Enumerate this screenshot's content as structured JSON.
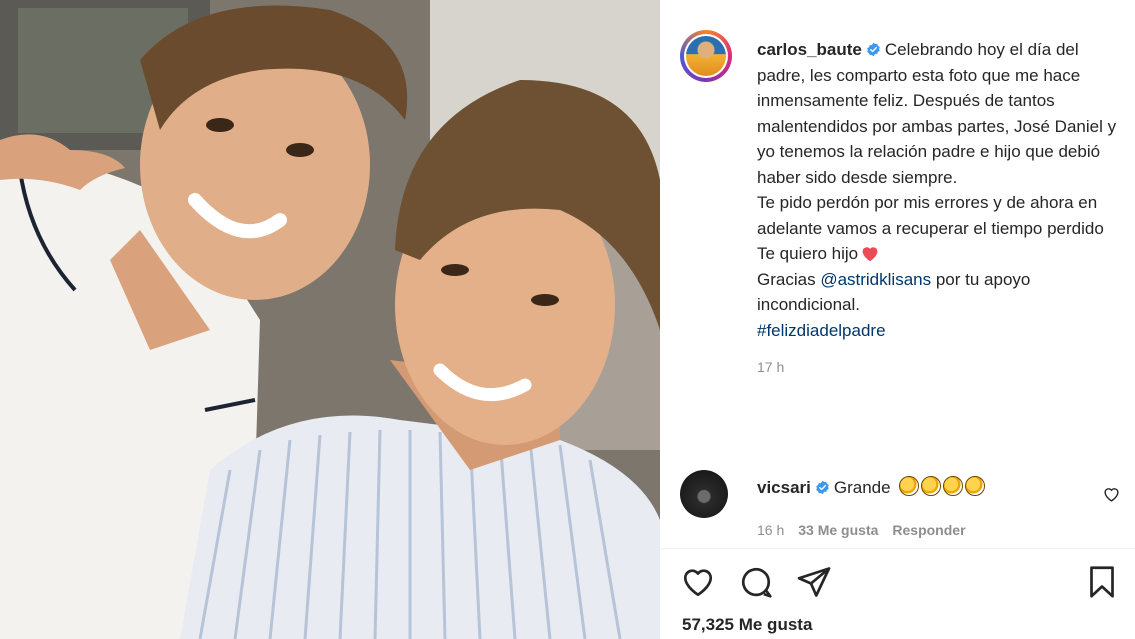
{
  "post": {
    "username": "carlos_baute",
    "caption_lines": [
      "Celebrando hoy el día del padre, les comparto esta foto que me hace inmensamente feliz. Después de tantos malentendidos por ambas partes, José Daniel y yo tenemos la relación padre e hijo que debió haber sido desde siempre.",
      "Te pido perdón por mis errores y de ahora en adelante vamos a recuperar el tiempo perdido",
      "Te quiero hijo"
    ],
    "thanks_prefix": "Gracias",
    "mention": "@astridklisans",
    "thanks_suffix": "por tu apoyo incondicional.",
    "hashtag": "#felizdiadelpadre",
    "timestamp": "17 h",
    "likes": "57,325 Me gusta"
  },
  "comment": {
    "username": "vicsari",
    "text": "Grande",
    "time": "16 h",
    "likes": "33 Me gusta",
    "reply": "Responder"
  },
  "icons": {
    "verified": "verified-badge-icon",
    "heart": "heart-icon",
    "comment": "comment-icon",
    "share": "share-icon",
    "save": "bookmark-icon"
  },
  "colors": {
    "verified": "#3897f0",
    "link": "#00376b",
    "muted": "#8e8e8e",
    "red_heart": "#ed4956"
  }
}
